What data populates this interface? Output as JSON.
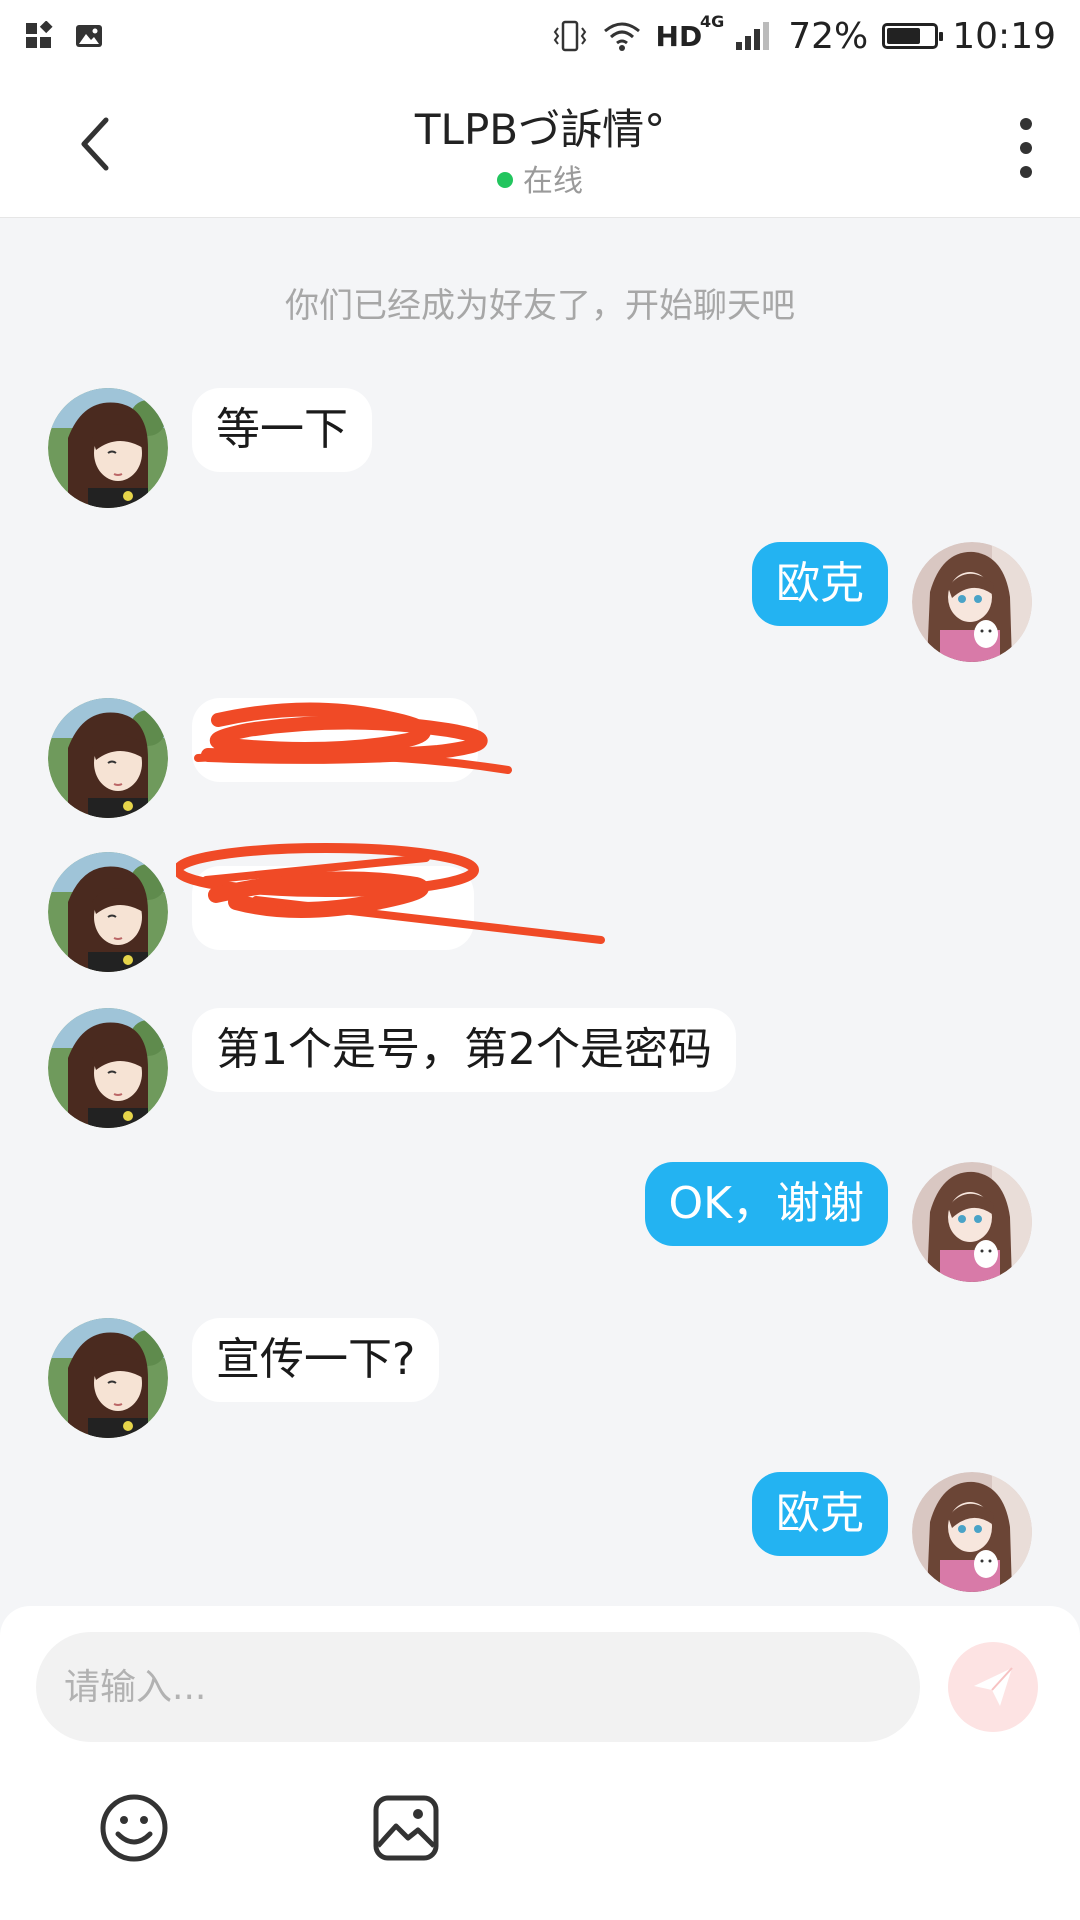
{
  "status_bar": {
    "network": "HD",
    "network_gen": "4G",
    "battery_percent": "72%",
    "battery_level": 0.72,
    "time": "10:19",
    "icons": [
      "widget-icon",
      "gallery-icon",
      "vibrate-icon",
      "wifi-icon",
      "signal-icon",
      "battery-icon"
    ]
  },
  "header": {
    "title": "TLPBづ訴情°",
    "status": "在线",
    "status_color": "#22c55e"
  },
  "chat": {
    "system_note": "你们已经成为好友了，开始聊天吧",
    "messages": [
      {
        "side": "left",
        "text": "等一下"
      },
      {
        "side": "right",
        "text": "欧克"
      },
      {
        "side": "left",
        "text": "",
        "redacted": true
      },
      {
        "side": "left",
        "text": "",
        "redacted": true
      },
      {
        "side": "left",
        "text": "第1个是号，第2个是密码"
      },
      {
        "side": "right",
        "text": "OK，谢谢"
      },
      {
        "side": "left",
        "text": "宣传一下?"
      },
      {
        "side": "right",
        "text": "欧克"
      }
    ]
  },
  "composer": {
    "placeholder": "请输入...",
    "send_icon": "send-icon",
    "tools": [
      "emoji-icon",
      "image-icon"
    ]
  },
  "colors": {
    "accent_bubble": "#23b3f2",
    "redaction": "#f04a26"
  }
}
